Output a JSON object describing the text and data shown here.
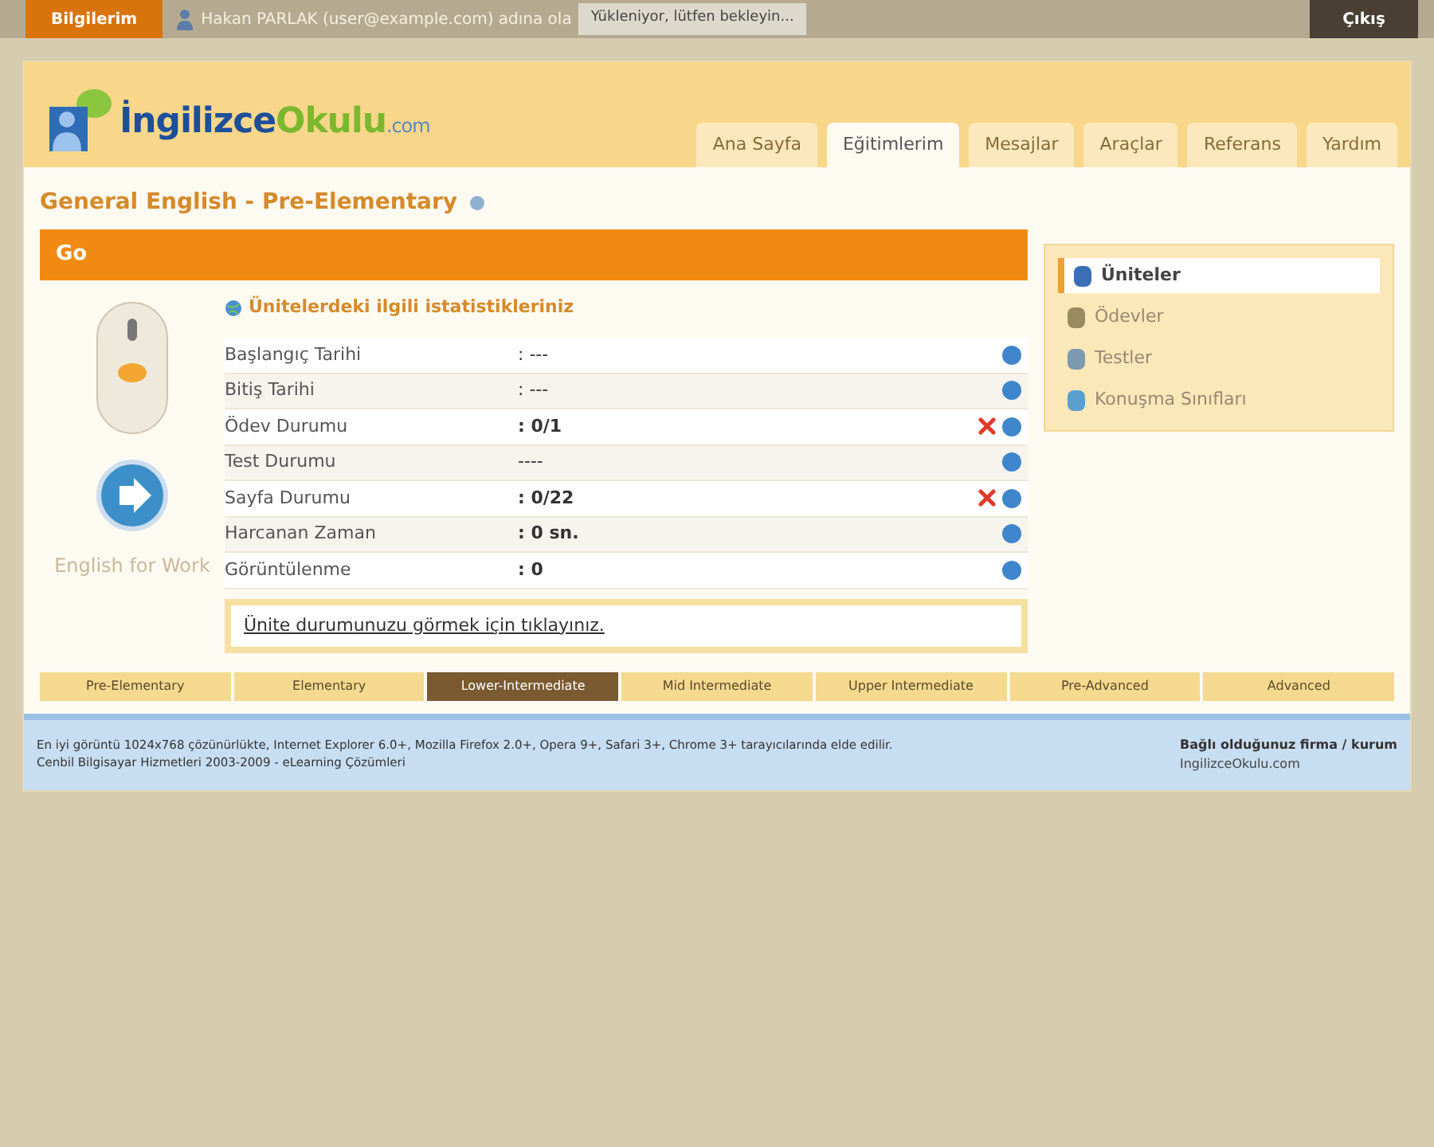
{
  "top_bar": {
    "profile_button": "Bilgilerim",
    "user_text": "Hakan PARLAK (user@example.com) adına ola",
    "loading_tooltip": "Yükleniyor, lütfen bekleyin...",
    "logout_button": "Çıkış"
  },
  "header": {
    "logo": {
      "main": "İngilizce",
      "accent": "Okulu",
      "suffix": ".com"
    },
    "tabs": [
      {
        "label": "Ana Sayfa",
        "selected": false
      },
      {
        "label": "Eğitimlerim",
        "selected": true
      },
      {
        "label": "Mesajlar",
        "selected": false
      },
      {
        "label": "Araçlar",
        "selected": false
      },
      {
        "label": "Referans",
        "selected": false
      },
      {
        "label": "Yardım",
        "selected": false
      }
    ]
  },
  "course": {
    "title": "General English - Pre-Elementary",
    "bar_label": "Go",
    "side_heading": "English for Work"
  },
  "stats": {
    "heading": "Ünitelerdeki ilgili istatistikleriniz",
    "rows": [
      {
        "label": "Başlangıç Tarihi",
        "value": ": ---",
        "error": false,
        "bold": false
      },
      {
        "label": "Bitiş Tarihi",
        "value": ": ---",
        "error": false,
        "bold": false
      },
      {
        "label": "Ödev Durumu",
        "value": ": 0/1",
        "error": true,
        "bold": true
      },
      {
        "label": "Test Durumu",
        "value": "----",
        "error": false,
        "bold": false
      },
      {
        "label": "Sayfa Durumu",
        "value": ": 0/22",
        "error": true,
        "bold": true
      },
      {
        "label": "Harcanan Zaman",
        "value": ": 0 sn.",
        "error": false,
        "bold": true
      },
      {
        "label": "Görüntülenme",
        "value": ": 0",
        "error": false,
        "bold": true
      }
    ],
    "link": "Ünite durumunuzu görmek için tıklayınız."
  },
  "side_menu": [
    {
      "label": "Üniteler",
      "selected": true
    },
    {
      "label": "Ödevler",
      "selected": false
    },
    {
      "label": "Testler",
      "selected": false
    },
    {
      "label": "Konuşma Sınıfları",
      "selected": false
    }
  ],
  "levels": [
    {
      "label": "Pre-Elementary",
      "selected": false
    },
    {
      "label": "Elementary",
      "selected": false
    },
    {
      "label": "Lower-Intermediate",
      "selected": true
    },
    {
      "label": "Mid Intermediate",
      "selected": false
    },
    {
      "label": "Upper Intermediate",
      "selected": false
    },
    {
      "label": "Pre-Advanced",
      "selected": false
    },
    {
      "label": "Advanced",
      "selected": false
    }
  ],
  "footer": {
    "lines": [
      "En iyi görüntü 1024x768 çözünürlükte, Internet Explorer 6.0+, Mozilla Firefox 2.0+, Opera 9+, Safari 3+, Chrome 3+ tarayıcılarında elde edilir.",
      "Cenbil Bilgisayar Hizmetleri 2003-2009 - eLearning Çözümleri"
    ],
    "company_heading": "Bağlı olduğunuz firma / kurum",
    "company": "IngilizceOkulu.com"
  }
}
